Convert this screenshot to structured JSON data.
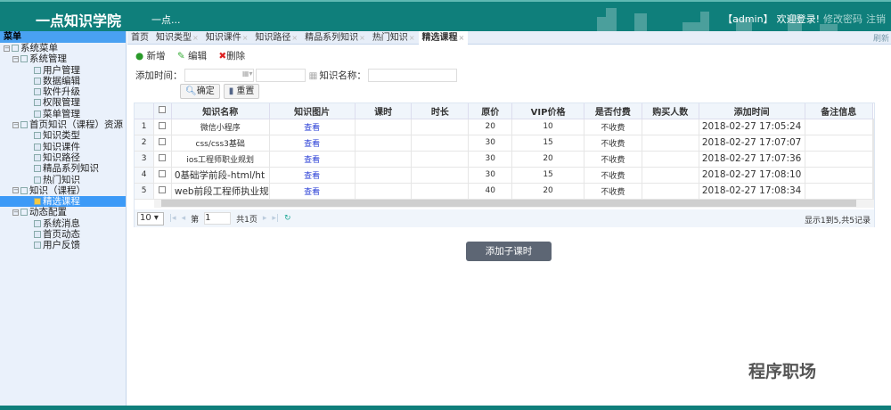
{
  "header": {
    "logo": "一点知识学院",
    "subtitle": "一点...",
    "user": "【admin】",
    "welcome": "欢迎登录!",
    "change_password": "修改密码",
    "logout": "注销"
  },
  "sidebar": {
    "title": "菜单",
    "items": [
      {
        "label": "系统菜单",
        "level": 0
      },
      {
        "label": "系统管理",
        "level": 1
      },
      {
        "label": "用户管理",
        "level": 2
      },
      {
        "label": "数据编辑",
        "level": 2
      },
      {
        "label": "软件升级",
        "level": 2
      },
      {
        "label": "权限管理",
        "level": 2
      },
      {
        "label": "菜单管理",
        "level": 2
      },
      {
        "label": "首页知识（课程）资源",
        "level": 1
      },
      {
        "label": "知识类型",
        "level": 2
      },
      {
        "label": "知识课件",
        "level": 2
      },
      {
        "label": "知识路径",
        "level": 2
      },
      {
        "label": "精品系列知识",
        "level": 2
      },
      {
        "label": "热门知识",
        "level": 2
      },
      {
        "label": "知识（课程）",
        "level": 1
      },
      {
        "label": "精选课程",
        "level": 2,
        "selected": true
      },
      {
        "label": "动态配置",
        "level": 1
      },
      {
        "label": "系统消息",
        "level": 2
      },
      {
        "label": "首页动态",
        "level": 2
      },
      {
        "label": "用户反馈",
        "level": 2
      }
    ]
  },
  "tabs": {
    "items": [
      "首页",
      "知识类型",
      "知识课件",
      "知识路径",
      "精品系列知识",
      "热门知识",
      "精选课程"
    ],
    "active": 6,
    "refresh": "刷新"
  },
  "toolbar": {
    "add": "新增",
    "edit": "编辑",
    "delete": "删除"
  },
  "filters": {
    "add_time_label": "添加时间：",
    "name_label": "知识名称：",
    "confirm": "确定",
    "reset": "重置"
  },
  "table": {
    "columns": [
      "知识名称",
      "知识图片",
      "课时",
      "时长",
      "原价",
      "VIP价格",
      "是否付费",
      "购买人数",
      "添加时间",
      "备注信息"
    ],
    "rows": [
      [
        "1",
        "微信小程序",
        "查看",
        "",
        "",
        "20",
        "10",
        "不收费",
        "",
        "2018-02-27 17:05:24",
        ""
      ],
      [
        "2",
        "css/css3基础",
        "查看",
        "",
        "",
        "30",
        "15",
        "不收费",
        "",
        "2018-02-27 17:07:07",
        ""
      ],
      [
        "3",
        "ios工程师职业规划",
        "查看",
        "",
        "",
        "30",
        "20",
        "不收费",
        "",
        "2018-02-27 17:07:36",
        ""
      ],
      [
        "4",
        "0基础学前段-html/ht",
        "查看",
        "",
        "",
        "30",
        "15",
        "不收费",
        "",
        "2018-02-27 17:08:10",
        ""
      ],
      [
        "5",
        "web前段工程师执业规",
        "查看",
        "",
        "",
        "40",
        "20",
        "不收费",
        "",
        "2018-02-27 17:08:34",
        ""
      ]
    ]
  },
  "pager": {
    "page_size": "10",
    "page_prefix": "第",
    "page": "1",
    "total_pages": "共1页",
    "info": "显示1到5,共5记录"
  },
  "add_sub_button": "添加子课时",
  "watermark": "程序职场"
}
